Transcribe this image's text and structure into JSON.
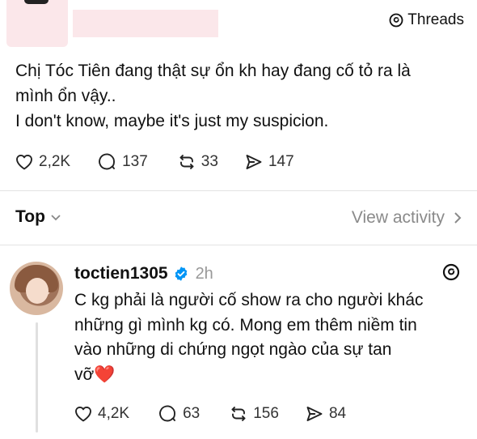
{
  "brand": {
    "label": "Threads"
  },
  "post": {
    "lines": [
      "Chị Tóc Tiên đang thật sự ổn kh hay đang cố tỏ ra là",
      "mình ổn vậy..",
      "I don't know, maybe it's just my suspicion."
    ],
    "stats": {
      "likes": "2,2K",
      "replies": "137",
      "reposts": "33",
      "shares": "147"
    }
  },
  "sort": {
    "label": "Top",
    "view_activity": "View activity"
  },
  "reply": {
    "username": "toctien1305",
    "time": "2h",
    "lines": [
      "C kg phải là người cố show ra cho người khác",
      "những gì mình kg có. Mong em thêm niềm tin",
      "vào những di chứng ngọt ngào của sự tan",
      "vỡ"
    ],
    "emoji": "❤️",
    "stats": {
      "likes": "4,2K",
      "replies": "63",
      "reposts": "156",
      "shares": "84"
    }
  },
  "colors": {
    "verified": "#0095f6",
    "heart": "#e0202b",
    "muted": "#8a8a8a"
  }
}
